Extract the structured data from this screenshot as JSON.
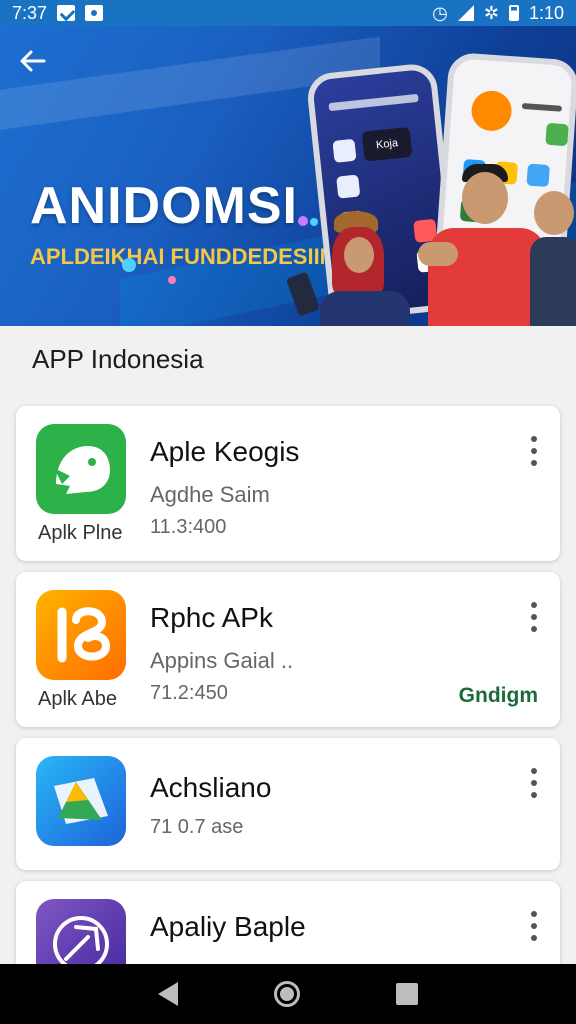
{
  "status_bar": {
    "time_left": "7:37",
    "time_right": "1:10"
  },
  "header": {
    "back_icon": "arrow-left-icon"
  },
  "banner": {
    "title": "ANIDOMSI",
    "subtitle": "APLDEIKHAI FUNDDEDESIIN",
    "phone_text": "Koja"
  },
  "section": {
    "title": "APP Indonesia"
  },
  "apps": [
    {
      "name": "Aple Keogis",
      "desc": "Agdhe Saim",
      "meta": "11.3:400",
      "sub_label": "Aplk Plne",
      "icon": "chat-bird-icon",
      "color": "#2db24a"
    },
    {
      "name": "Rphc APk",
      "desc": "Appins Gaial ..",
      "meta": "71.2:450",
      "sub_label": "Aplk Abe",
      "action": "Gndigm",
      "icon": "orange-b-icon",
      "color": "#ff8a00"
    },
    {
      "name": "Achsliano",
      "desc": "",
      "meta": "71 0.7 ase",
      "sub_label": "",
      "icon": "folder-triangle-icon",
      "color": "#1e88e5"
    },
    {
      "name": "Apaliy Baple",
      "desc": "",
      "meta": "",
      "sub_label": "",
      "icon": "compass-icon",
      "color": "#5e35b1"
    }
  ],
  "nav": {
    "back": "back-icon",
    "home": "home-icon",
    "recents": "recents-icon"
  }
}
